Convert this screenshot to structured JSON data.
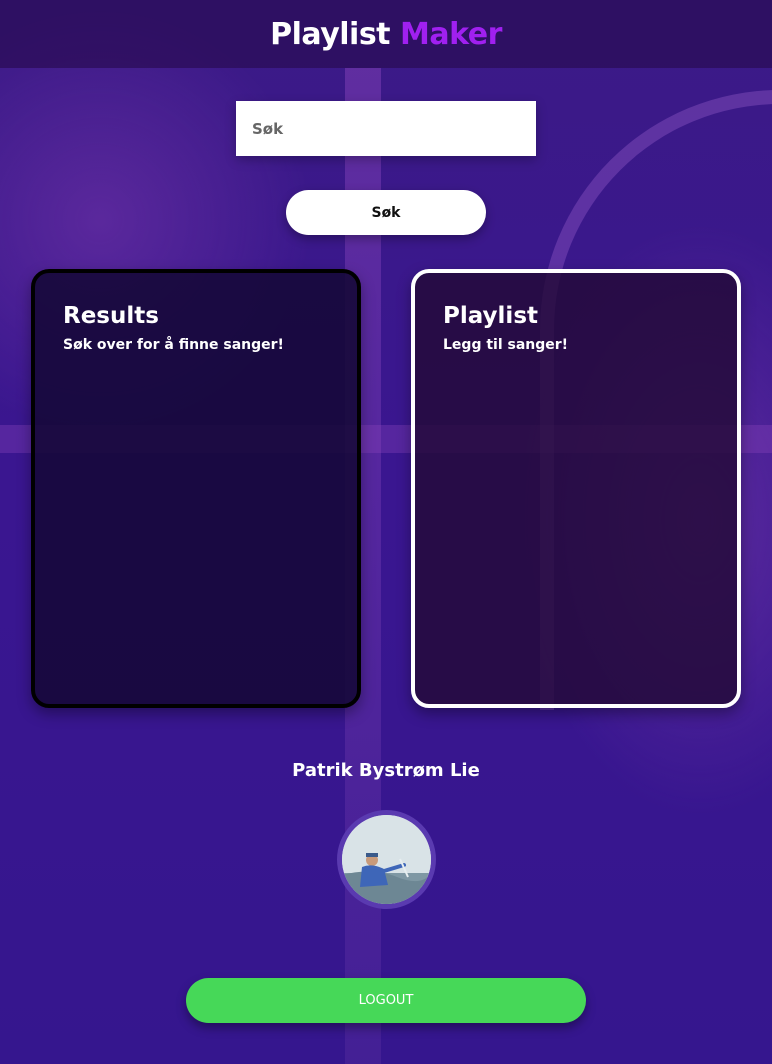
{
  "header": {
    "title_part1": "Playlist",
    "title_part2": "Maker"
  },
  "search": {
    "placeholder": "Søk",
    "value": "",
    "button_label": "Søk"
  },
  "results": {
    "heading": "Results",
    "hint": "Søk over for å finne sanger!"
  },
  "playlist": {
    "heading": "Playlist",
    "hint": "Legg til sanger!"
  },
  "user": {
    "name": "Patrik Bystrøm Lie",
    "avatar_icon": "user-avatar-photo"
  },
  "logout": {
    "label": "LOGOUT"
  },
  "colors": {
    "accent": "#a020f0",
    "background": "#3a1690",
    "logout": "#46d858"
  }
}
